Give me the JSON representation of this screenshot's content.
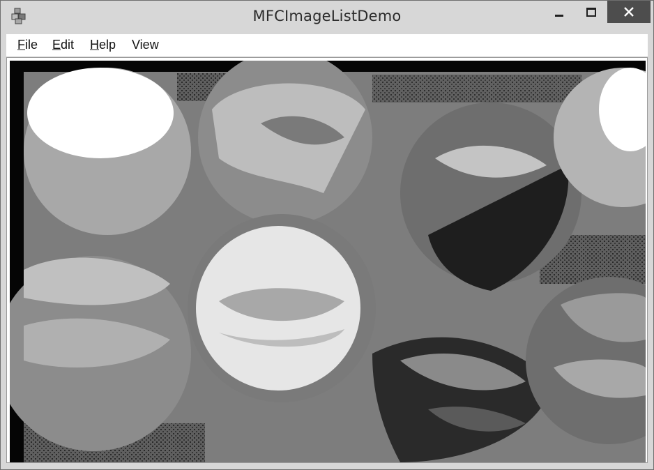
{
  "window": {
    "title": "MFCImageListDemo"
  },
  "titlebar": {
    "app_icon": "app-cubes-icon",
    "buttons": {
      "minimize_icon": "minimize-icon",
      "maximize_icon": "maximize-icon",
      "close_icon": "close-icon"
    }
  },
  "menu": {
    "items": [
      {
        "mnemonic": "F",
        "rest": "ile"
      },
      {
        "mnemonic": "E",
        "rest": "dit"
      },
      {
        "mnemonic": "H",
        "rest": "elp"
      },
      {
        "label": "View"
      }
    ]
  },
  "image": {
    "subject": "posterized grayscale photo of glossy spheres with lips",
    "palette": [
      "#050505",
      "#5a5a5a",
      "#8a8a8a",
      "#b4b4b4",
      "#dcdcdc",
      "#ffffff"
    ]
  }
}
